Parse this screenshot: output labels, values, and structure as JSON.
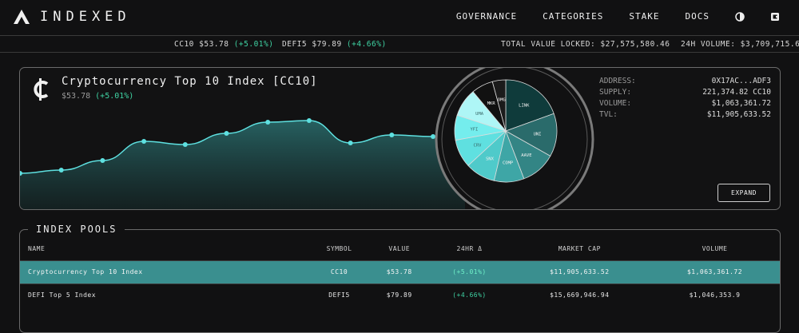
{
  "brand": {
    "name": "INDEXED"
  },
  "nav": {
    "governance": "GOVERNANCE",
    "categories": "CATEGORIES",
    "stake": "STAKE",
    "docs": "DOCS"
  },
  "ticker": {
    "cc10_symbol": "CC10",
    "cc10_price": "$53.78",
    "cc10_change": "(+5.01%)",
    "defi5_symbol": "DEFI5",
    "defi5_price": "$79.89",
    "defi5_change": "(+4.66%)",
    "tvl_label": "TOTAL VALUE LOCKED:",
    "tvl_value": "$27,575,580.46",
    "volume_label": "24H VOLUME:",
    "volume_value": "$3,709,715.62"
  },
  "index_card": {
    "title": "Cryptocurrency Top 10 Index [CC10]",
    "price": "$53.78",
    "change": "(+5.01%)",
    "expand_label": "EXPAND",
    "details": [
      {
        "label": "ADDRESS:",
        "value": "0X17AC...ADF3"
      },
      {
        "label": "SUPPLY:",
        "value": "221,374.82 CC10"
      },
      {
        "label": "VOLUME:",
        "value": "$1,063,361.72"
      },
      {
        "label": "TVL:",
        "value": "$11,905,633.52"
      }
    ]
  },
  "chart_data": {
    "type": "area",
    "values": [
      0.45,
      0.55,
      0.85,
      1.45,
      1.35,
      1.7,
      2.05,
      2.1,
      1.4,
      1.65,
      1.6
    ],
    "color": "#5ee0e0"
  },
  "pie": {
    "slices": [
      {
        "label": "LINK",
        "value": 18.5,
        "color": "#0f3b3b"
      },
      {
        "label": "UNI",
        "value": 13,
        "color": "#2a6b6b"
      },
      {
        "label": "AAVE",
        "value": 10.5,
        "color": "#338585"
      },
      {
        "label": "COMP",
        "value": 9,
        "color": "#3ea6a6"
      },
      {
        "label": "SNX",
        "value": 9,
        "color": "#4fcaca"
      },
      {
        "label": "CRV",
        "value": 8.5,
        "color": "#5fe0e0"
      },
      {
        "label": "YFI",
        "value": 7.5,
        "color": "#74eded"
      },
      {
        "label": "UMA",
        "value": 8.5,
        "color": "#aef6f6"
      },
      {
        "label": "MKR",
        "value": 6.5,
        "color": "#111"
      },
      {
        "label": "OMG",
        "value": 4,
        "color": "#1b1b1b"
      }
    ]
  },
  "pools": {
    "title": "INDEX POOLS",
    "columns": [
      "NAME",
      "SYMBOL",
      "VALUE",
      "24HR Δ",
      "MARKET CAP",
      "VOLUME"
    ],
    "rows": [
      {
        "name": "Cryptocurrency Top 10 Index",
        "symbol": "CC10",
        "value": "$53.78",
        "change": "(+5.01%)",
        "market_cap": "$11,905,633.52",
        "volume": "$1,063,361.72"
      },
      {
        "name": "DEFI Top 5 Index",
        "symbol": "DEFI5",
        "value": "$79.89",
        "change": "(+4.66%)",
        "market_cap": "$15,669,946.94",
        "volume": "$1,046,353.9"
      }
    ]
  },
  "colors": {
    "accent": "#3a8f8f",
    "positive": "#3fd3a3",
    "line": "#5ee0e0"
  }
}
